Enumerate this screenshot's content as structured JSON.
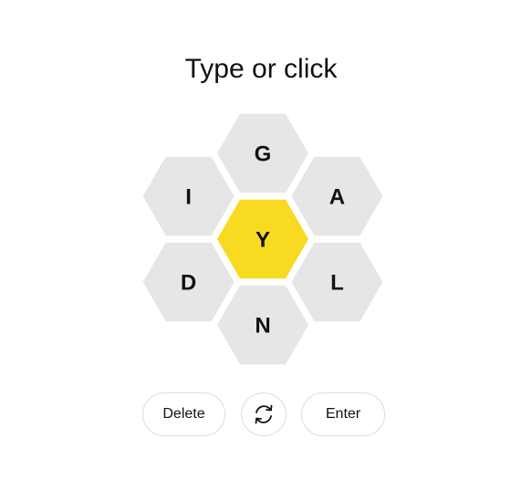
{
  "prompt": "Type or click",
  "hive": {
    "center_letter": "Y",
    "outer_letters": [
      "G",
      "A",
      "L",
      "N",
      "D",
      "I"
    ]
  },
  "controls": {
    "delete_label": "Delete",
    "shuffle_icon": "shuffle-icon",
    "enter_label": "Enter"
  },
  "colors": {
    "center_fill": "#f7da21",
    "outer_fill": "#e6e6e6",
    "text": "#111111",
    "button_border": "#dcdcdc"
  }
}
